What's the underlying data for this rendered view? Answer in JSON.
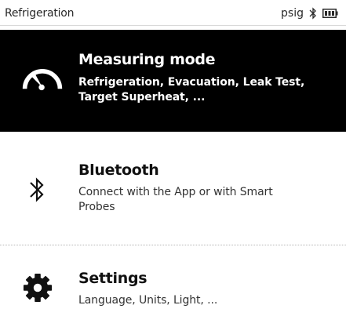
{
  "status_bar": {
    "title": "Refrigeration",
    "unit": "psig",
    "bluetooth_icon": "bluetooth-icon",
    "battery_icon": "battery-icon"
  },
  "menu": {
    "items": [
      {
        "id": "measuring-mode",
        "title": "Measuring mode",
        "description": "Refrigeration, Evacuation, Leak Test, Target Superheat, ...",
        "icon": "gauge-icon",
        "selected": true
      },
      {
        "id": "bluetooth",
        "title": "Bluetooth",
        "description": "Connect with the App or with Smart Probes",
        "icon": "bluetooth-icon",
        "selected": false
      },
      {
        "id": "settings",
        "title": "Settings",
        "description": "Language, Units, Light, ...",
        "icon": "gear-icon",
        "selected": false
      }
    ]
  },
  "colors": {
    "selected_background": "#000000",
    "selected_text": "#ffffff",
    "background": "#ffffff",
    "text": "#111111"
  }
}
